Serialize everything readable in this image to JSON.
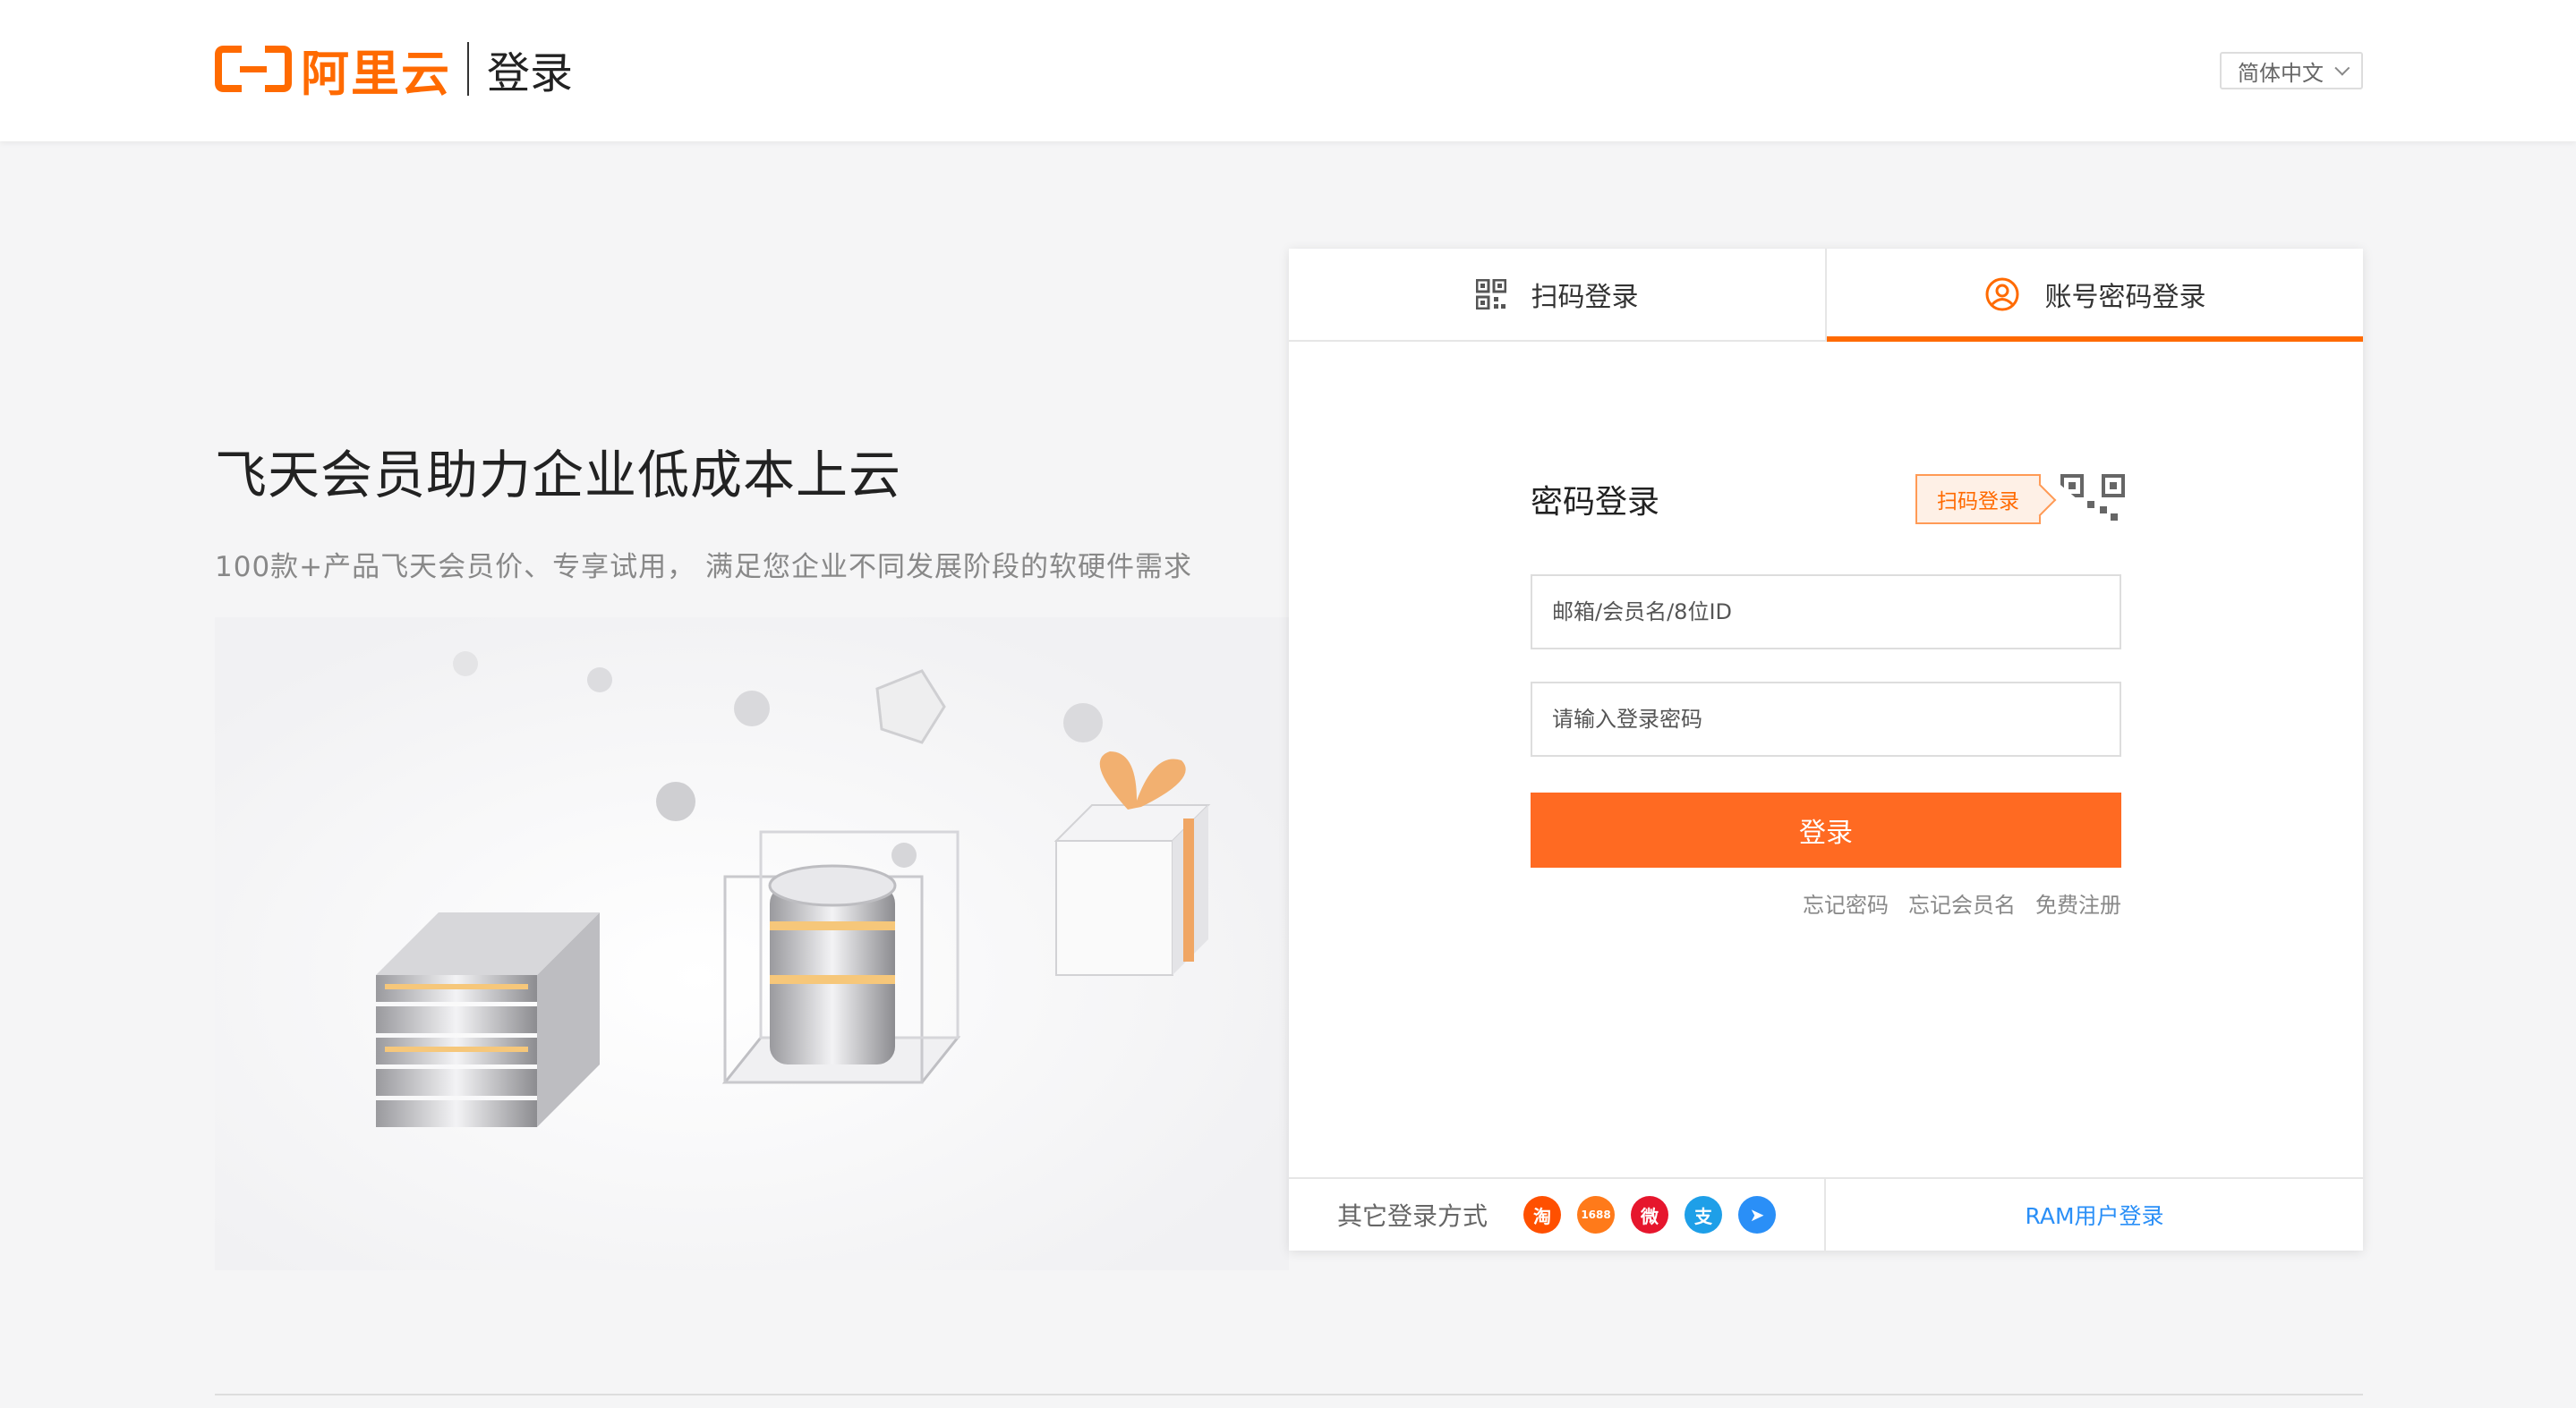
{
  "header": {
    "logo_text": "阿里云",
    "page_label": "登录",
    "language": "简体中文"
  },
  "promo": {
    "title": "飞天会员助力企业低成本上云",
    "subtitle": "100款+产品飞天会员价、专享试用， 满足您企业不同发展阶段的软硬件需求"
  },
  "tabs": [
    {
      "label": "扫码登录",
      "icon": "qr-code-icon",
      "active": false
    },
    {
      "label": "账号密码登录",
      "icon": "user-icon",
      "active": true
    }
  ],
  "form": {
    "title": "密码登录",
    "qr_tip": "扫码登录",
    "username_placeholder": "邮箱/会员名/8位ID",
    "password_placeholder": "请输入登录密码",
    "submit_label": "登录",
    "links": [
      "忘记密码",
      "忘记会员名",
      "免费注册"
    ]
  },
  "footer": {
    "other_label": "其它登录方式",
    "providers": [
      {
        "name": "taobao",
        "glyph": "淘",
        "color": "#ff5000"
      },
      {
        "name": "1688",
        "glyph": "1688",
        "color": "#ff7a1a"
      },
      {
        "name": "weibo",
        "glyph": "微",
        "color": "#e6162d"
      },
      {
        "name": "alipay",
        "glyph": "支",
        "color": "#1e9fe8"
      },
      {
        "name": "dingtalk",
        "glyph": "➤",
        "color": "#2a8ff7"
      }
    ],
    "ram_label": "RAM用户登录"
  },
  "colors": {
    "accent": "#ff6a00",
    "button": "#ff6a22",
    "link": "#2a8ff7"
  }
}
